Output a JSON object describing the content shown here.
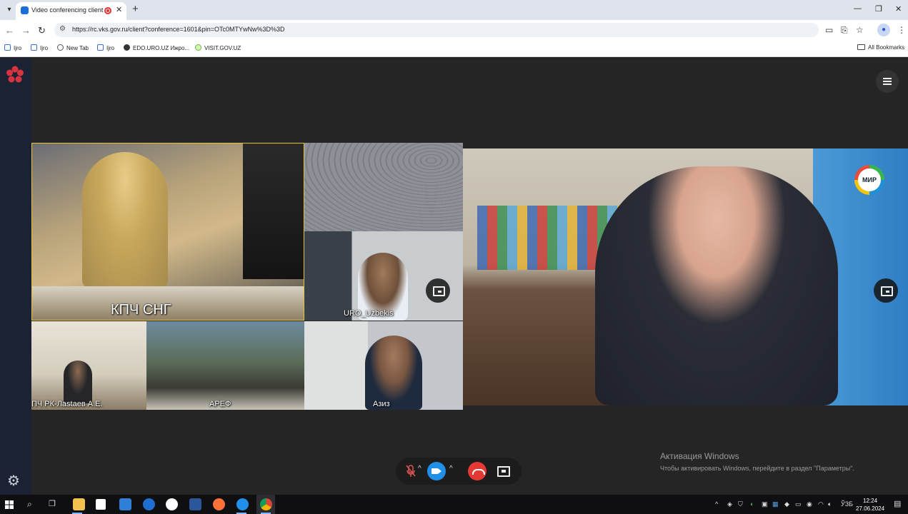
{
  "browser": {
    "tab_title": "Video conferencing client",
    "url": "https://rc.vks.gov.ru/client?conference=1601&pin=OTc0MTYwNw%3D%3D",
    "bookmarks": [
      "Ijro",
      "Ijro",
      "New Tab",
      "Ijro",
      "EDO.URO.UZ Ижро...",
      "VISIT.GOV.UZ"
    ],
    "all_bookmarks": "All Bookmarks"
  },
  "conference": {
    "participants": [
      {
        "name": "КПЧ СНГ"
      },
      {
        "name": "URO_Uzbekis"
      },
      {
        "name": "ПЧ РК-Лаstaeв А.Е."
      },
      {
        "name": "АРЕФ"
      },
      {
        "name": "Азиз"
      }
    ],
    "speaker_badge": "МИР"
  },
  "windows": {
    "activation_title": "Активация Windows",
    "activation_text": "Чтобы активировать Windows, перейдите в раздел \"Параметры\"."
  },
  "taskbar": {
    "language": "ЎЗБ",
    "time": "12:24",
    "date": "27.06.2024"
  },
  "colors": {
    "accent": "#1f8fe8",
    "hangup": "#e53935",
    "sidebar": "#1a2233"
  }
}
